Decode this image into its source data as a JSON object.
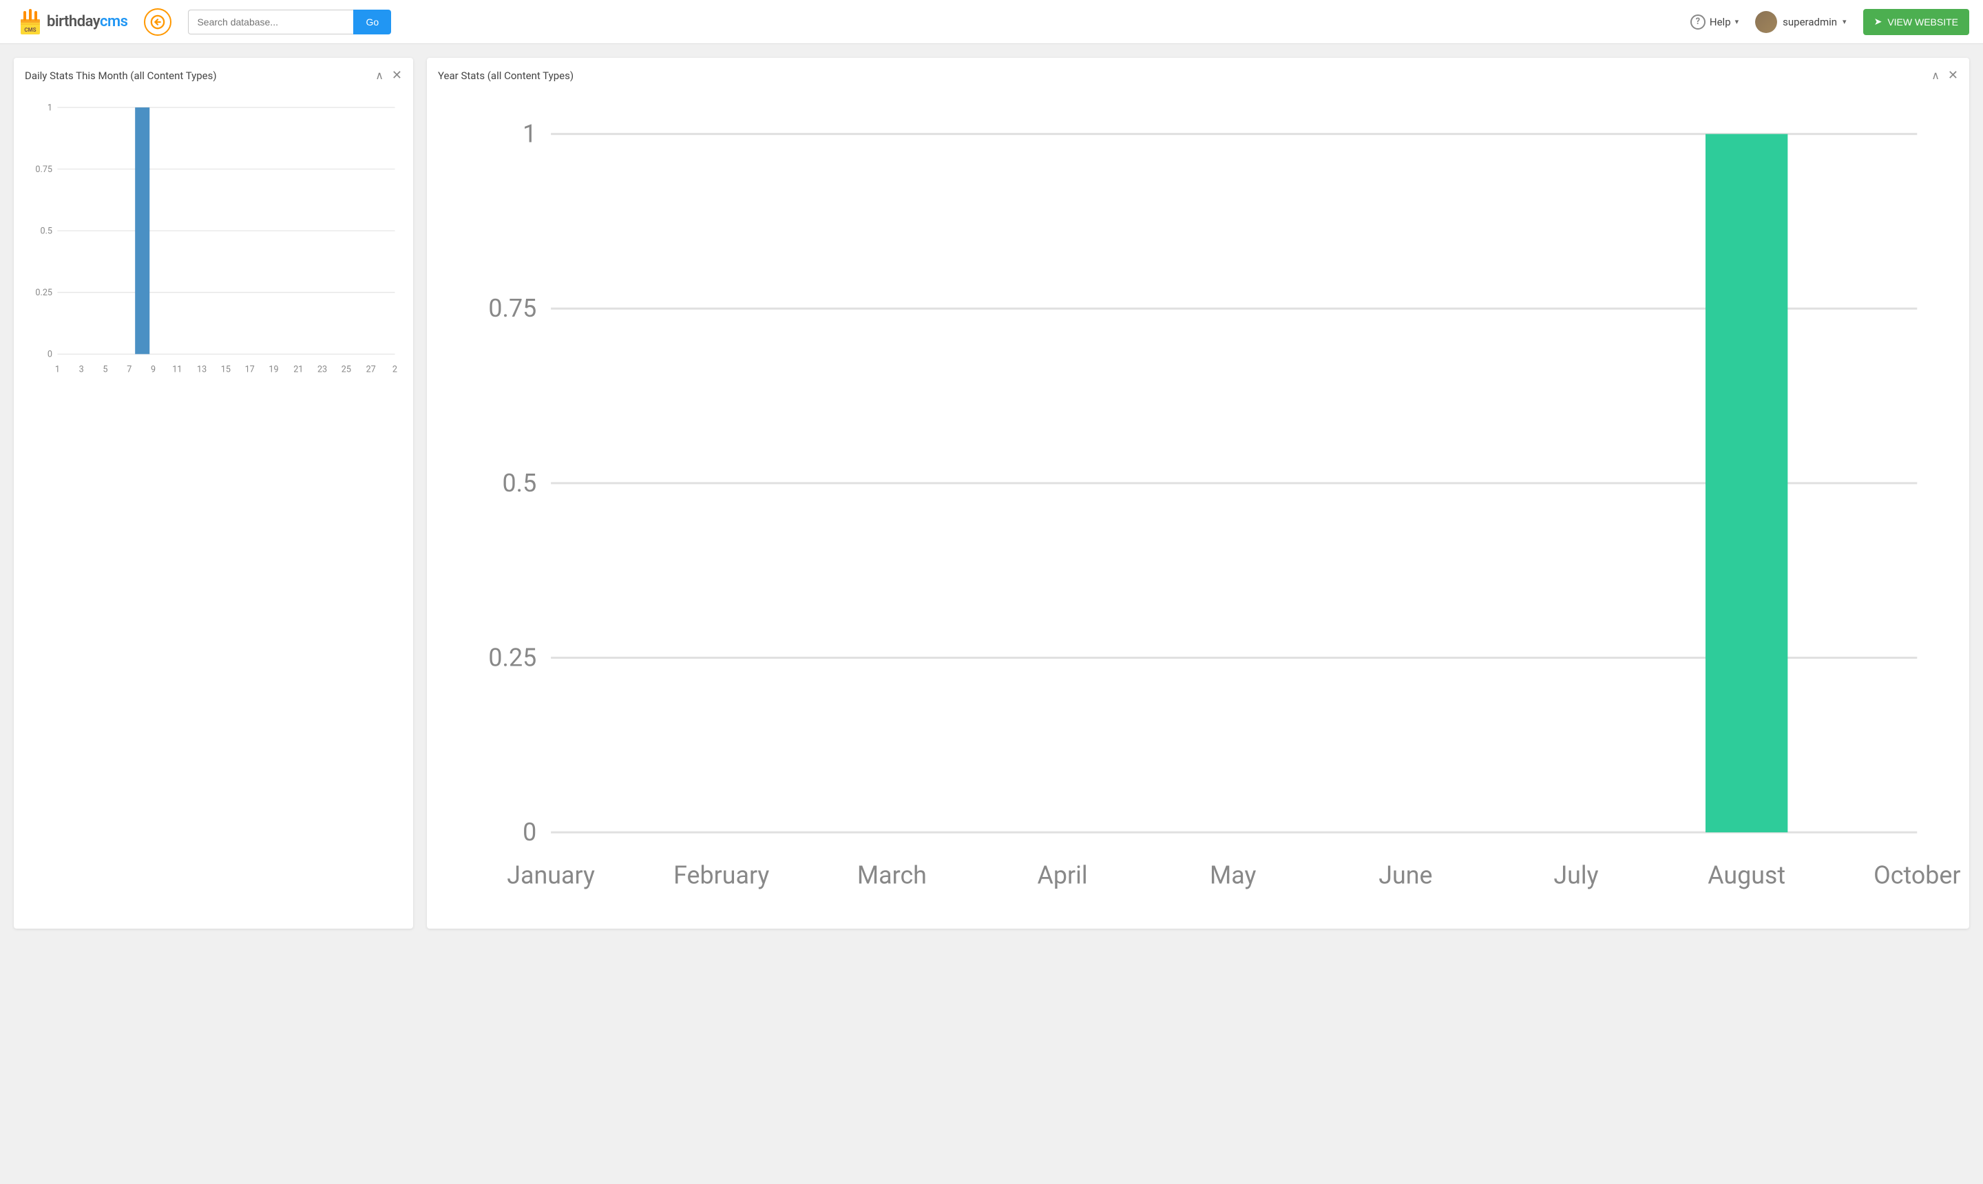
{
  "header": {
    "logo_birthday": "birthday",
    "logo_cms": "cms",
    "search_placeholder": "Search database...",
    "go_label": "Go",
    "help_label": "Help",
    "user_label": "superadmin",
    "view_website_label": "VIEW WEBSITE"
  },
  "daily_chart": {
    "title": "Daily Stats This Month (all Content Types)",
    "y_labels": [
      "1",
      "0.75",
      "0.5",
      "0.25",
      "0"
    ],
    "x_labels": [
      "1",
      "3",
      "5",
      "7",
      "9",
      "11",
      "13",
      "15",
      "17",
      "19",
      "21",
      "23",
      "25",
      "27",
      "2"
    ],
    "bar_index": 4,
    "bar_color": "#4A90C4",
    "bar_value": 1.0
  },
  "year_chart": {
    "title": "Year Stats (all Content Types)",
    "y_labels": [
      "1",
      "0.75",
      "0.5",
      "0.25",
      "0"
    ],
    "x_labels": [
      "January",
      "February",
      "March",
      "April",
      "May",
      "June",
      "July",
      "August",
      "October"
    ],
    "bar_index": 7,
    "bar_color": "#2ECC9A",
    "bar_value": 1.0
  }
}
